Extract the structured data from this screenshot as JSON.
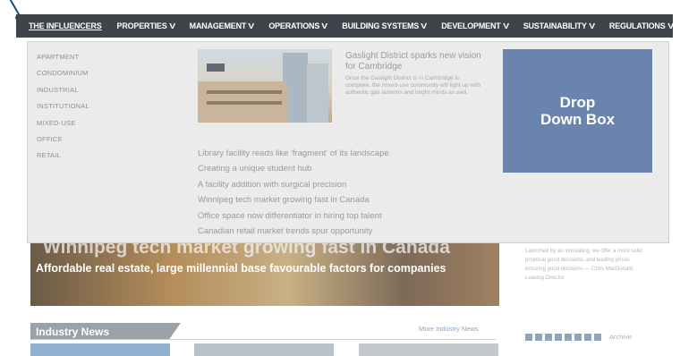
{
  "nav": {
    "items": [
      {
        "label": "THE INFLUENCERS",
        "has_chevron": false
      },
      {
        "label": "PROPERTIES",
        "has_chevron": true
      },
      {
        "label": "MANAGEMENT",
        "has_chevron": true
      },
      {
        "label": "OPERATIONS",
        "has_chevron": true
      },
      {
        "label": "BUILDING SYSTEMS",
        "has_chevron": true
      },
      {
        "label": "DEVELOPMENT",
        "has_chevron": true
      },
      {
        "label": "SUSTAINABILITY",
        "has_chevron": true
      },
      {
        "label": "REGULATIONS",
        "has_chevron": true
      }
    ],
    "chevron": "V"
  },
  "dropdown": {
    "categories": [
      "APARTMENT",
      "CONDOMINIUM",
      "INDUSTRIAL",
      "INSTITUTIONAL",
      "MIXED-USE",
      "OFFICE",
      "RETAIL"
    ],
    "feature": {
      "title": "Gaslight District sparks new vision for Cambridge",
      "blurb": "Once the Gaslight District is in Cambridge is complete, the mixed-use community will light up with authentic gas lanterns and bright minds as well."
    },
    "headlines": [
      "Library facility reads like 'fragment' of its landscape",
      "Creating a unique student hub",
      "A facility addition with surgical precision",
      "Winnipeg tech market growing fast in Canada",
      "Office space now differentiator in hiring top talent",
      "Canadian retail market trends spur opportunity"
    ],
    "box_label": "Drop\nDown Box"
  },
  "hero": {
    "title": "Winnipeg tech market growing fast in Canada",
    "subtitle": "Affordable real estate, large millennial base favourable factors for companies"
  },
  "sidebar": {
    "quote": "Launched by an innovating, we offer a more solid proposal good decisions, and leading prices ensuring good decisions — Chris MacDonald, Leasing Director"
  },
  "news": {
    "heading": "Industry News",
    "more_link": "More Industry News",
    "archive_link": "Archive",
    "pager_count": 8
  },
  "colors": {
    "nav_bg": "#3f444b",
    "dropdown_bg": "#ebebeb",
    "blue_box": "#6b84ad",
    "pointer": "#1f4d7a"
  }
}
